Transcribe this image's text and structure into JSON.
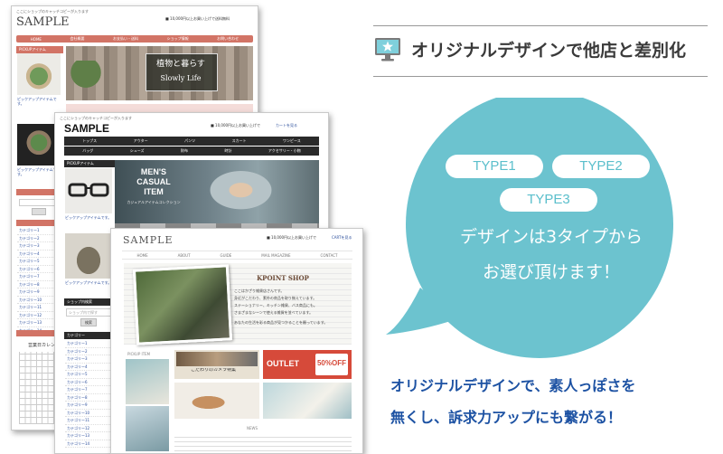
{
  "heading": {
    "title": "オリジナルデザインで他店と差別化"
  },
  "bubble": {
    "types": [
      "TYPE1",
      "TYPE2",
      "TYPE3"
    ],
    "line1": "デザインは3タイプから",
    "line2": "お選び頂けます！"
  },
  "caption": {
    "line1": "オリジナルデザインで、素人っぽさを",
    "line2": "無くし、訴求力アップにも繋がる！"
  },
  "colors": {
    "accent": "#5bbfcc",
    "caption": "#1d52a3",
    "type1_nav": "#d27466",
    "type2_nav": "#2a2a2a"
  },
  "shot1": {
    "logo": "SAMPLE",
    "nav": [
      "HOME",
      "会社概要",
      "お支払い・送料",
      "ショップ情報",
      "お問い合わせ"
    ],
    "hero_line1": "植物と暮らす",
    "hero_line2": "Slowly Life",
    "side_title": "PICKUPアイテム",
    "categories": [
      "カテゴリー1",
      "カテゴリー2",
      "カテゴリー3",
      "カテゴリー4",
      "カテゴリー5",
      "カテゴリー6",
      "カテゴリー7",
      "カテゴリー8",
      "カテゴリー9",
      "カテゴリー10",
      "カテゴリー11",
      "カテゴリー12",
      "カテゴリー13",
      "カテゴリー14"
    ],
    "calendar_title": "営業日カレンダー"
  },
  "shot2": {
    "logo": "SAMPLE",
    "nav_row1": [
      "トップス",
      "アウター",
      "パンツ",
      "スカート",
      "ワンピース"
    ],
    "nav_row2": [
      "バッグ",
      "シューズ",
      "財布",
      "時計",
      "アクセサリー・小物"
    ],
    "side_title": "PICKUPアイテム",
    "hero_line1": "MEN'S",
    "hero_line2": "CASUAL",
    "hero_line3": "ITEM",
    "hero_sub": "カジュアルアイテムコレクション",
    "search_title": "ショップ内検索",
    "search_placeholder": "ショップ内で探す",
    "search_button": "検索",
    "category_title": "カテゴリー",
    "categories": [
      "カテゴリー1",
      "カテゴリー2",
      "カテゴリー3",
      "カテゴリー4",
      "カテゴリー5",
      "カテゴリー6",
      "カテゴリー7",
      "カテゴリー8",
      "カテゴリー9",
      "カテゴリー10",
      "カテゴリー11",
      "カテゴリー12",
      "カテゴリー13",
      "カテゴリー14"
    ]
  },
  "shot3": {
    "logo": "SAMPLE",
    "nav": [
      "HOME",
      "ABOUT",
      "GUIDE",
      "MAIL MAGAZINE",
      "CONTACT"
    ],
    "kpoint": "KPOINT SHOP",
    "kpoint_lines": [
      "ここはかざり雑貨店さんです。",
      "身近がこだわり、素朴の商品を取り揃えています。",
      "ステーショナリー、キッチン雑貨、バス商品にも。",
      "さまざまなシーンで使える雑貨を並べています。",
      "あなたの生活を彩る商品が見つかることを願っています。"
    ],
    "pickup_label": "PICKUP ITEM",
    "outlet_text": "OUTLET",
    "outlet_pct": "50%OFF",
    "special_text": "こだわりのカメラ特集",
    "news_label": "NEWS"
  }
}
